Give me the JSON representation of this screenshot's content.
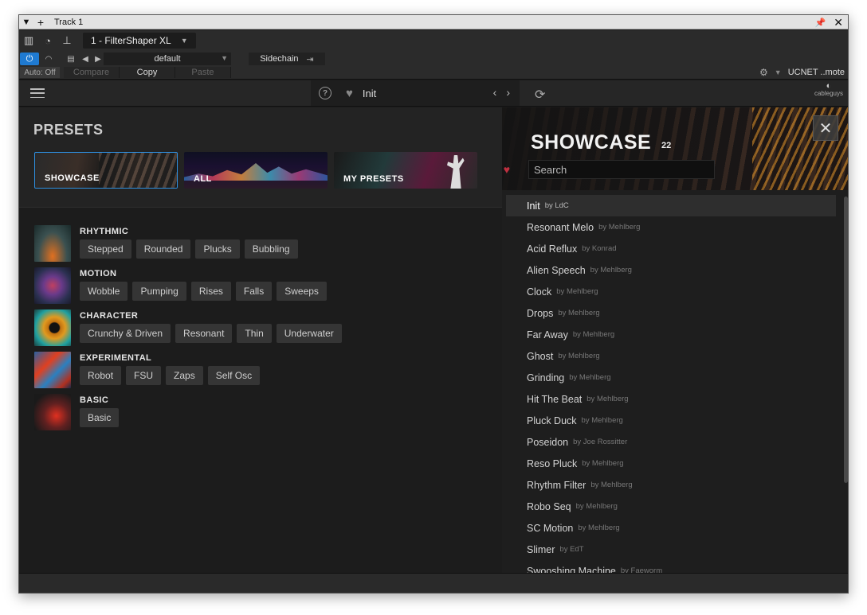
{
  "window": {
    "title": "Track 1",
    "plugin_name": "1 - FilterShaper XL"
  },
  "host": {
    "preset_name": "default",
    "sidechain_label": "Sidechain",
    "auto_label": "Auto: Off",
    "compare_label": "Compare",
    "copy_label": "Copy",
    "paste_label": "Paste",
    "remote_label": "UCNET ..mote"
  },
  "plugin_header": {
    "current_preset": "Init",
    "logo_text": "cableguys"
  },
  "presets_panel": {
    "title": "PRESETS",
    "categories": [
      {
        "label": "SHOWCASE"
      },
      {
        "label": "ALL"
      },
      {
        "label": "MY PRESETS"
      }
    ],
    "groups": [
      {
        "title": "RHYTHMIC",
        "tags": [
          "Stepped",
          "Rounded",
          "Plucks",
          "Bubbling"
        ]
      },
      {
        "title": "MOTION",
        "tags": [
          "Wobble",
          "Pumping",
          "Rises",
          "Falls",
          "Sweeps"
        ]
      },
      {
        "title": "CHARACTER",
        "tags": [
          "Crunchy & Driven",
          "Resonant",
          "Thin",
          "Underwater"
        ]
      },
      {
        "title": "EXPERIMENTAL",
        "tags": [
          "Robot",
          "FSU",
          "Zaps",
          "Self Osc"
        ]
      },
      {
        "title": "BASIC",
        "tags": [
          "Basic"
        ]
      }
    ]
  },
  "showcase": {
    "title": "SHOWCASE",
    "count": "22",
    "search_placeholder": "Search",
    "items": [
      {
        "name": "Init",
        "author": "by LdC"
      },
      {
        "name": "Resonant Melo",
        "author": "by Mehlberg"
      },
      {
        "name": "Acid Reflux",
        "author": "by Konrad"
      },
      {
        "name": "Alien Speech",
        "author": "by Mehlberg"
      },
      {
        "name": "Clock",
        "author": "by Mehlberg"
      },
      {
        "name": "Drops",
        "author": "by Mehlberg"
      },
      {
        "name": "Far Away",
        "author": "by Mehlberg"
      },
      {
        "name": "Ghost",
        "author": "by Mehlberg"
      },
      {
        "name": "Grinding",
        "author": "by Mehlberg"
      },
      {
        "name": "Hit The Beat",
        "author": "by Mehlberg"
      },
      {
        "name": "Pluck Duck",
        "author": "by Mehlberg"
      },
      {
        "name": "Poseidon",
        "author": "by Joe Rossitter"
      },
      {
        "name": "Reso Pluck",
        "author": "by Mehlberg"
      },
      {
        "name": "Rhythm Filter",
        "author": "by Mehlberg"
      },
      {
        "name": "Robo Seq",
        "author": "by Mehlberg"
      },
      {
        "name": "SC Motion",
        "author": "by Mehlberg"
      },
      {
        "name": "Slimer",
        "author": "by EdT"
      },
      {
        "name": "Swooshing Machine",
        "author": "by Faeworm"
      }
    ]
  },
  "colors": {
    "accent": "#2e8fe0",
    "power": "#1f7ad1",
    "favorite": "#c03040"
  }
}
